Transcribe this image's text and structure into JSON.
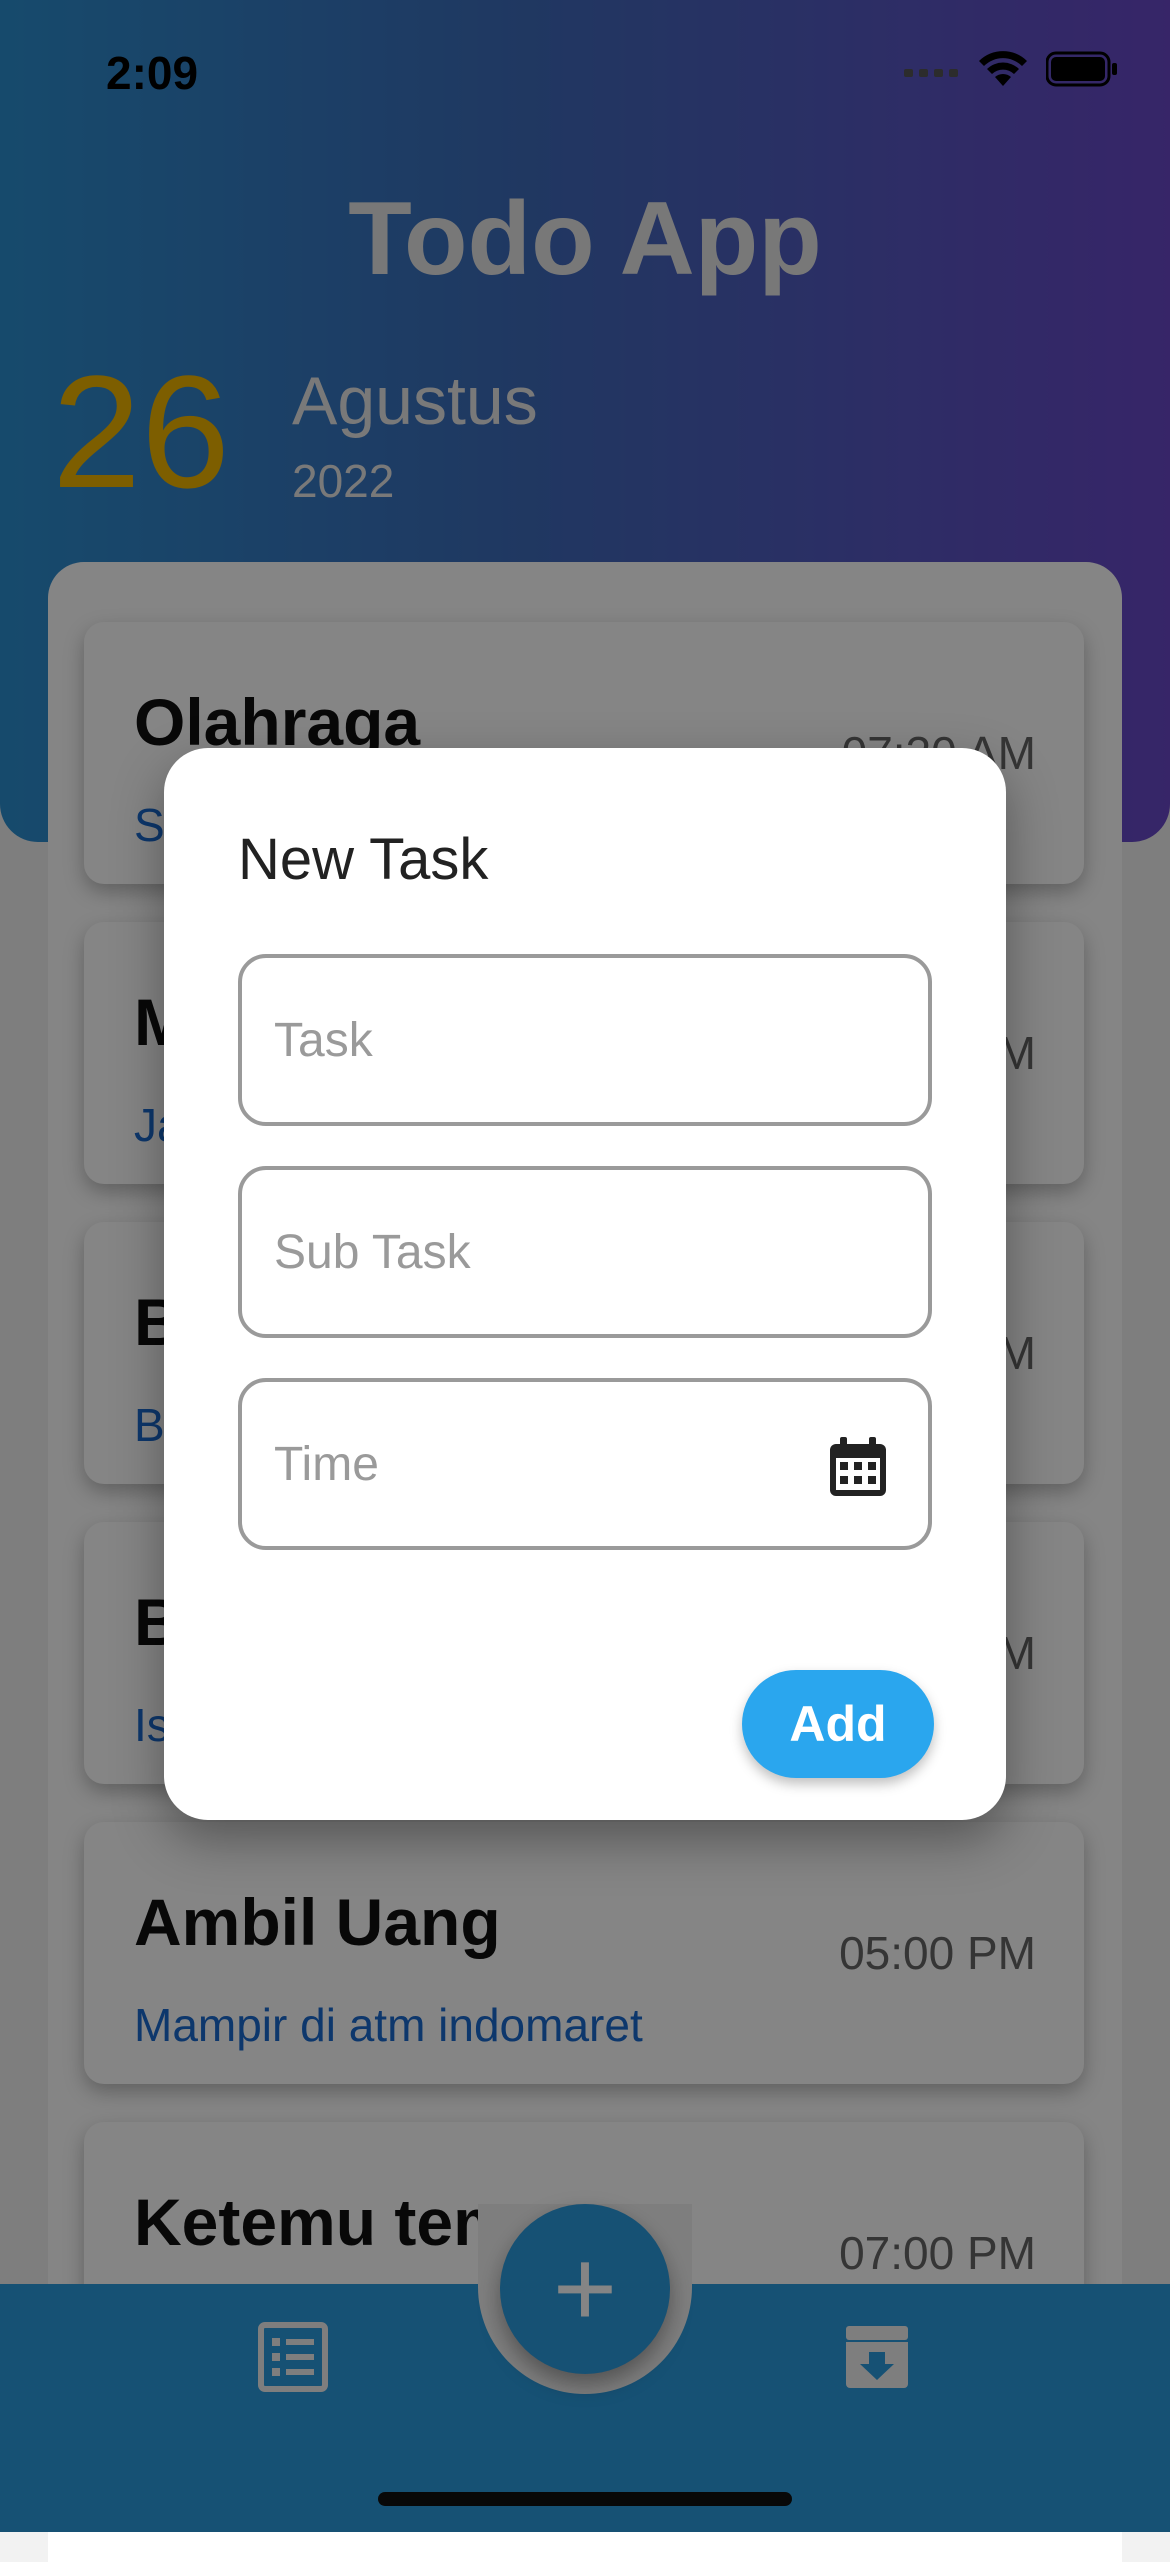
{
  "status_bar": {
    "time": "2:09",
    "icons": [
      "signal-icon",
      "wifi-icon",
      "battery-icon"
    ]
  },
  "header": {
    "title": "Todo App",
    "date": {
      "day": "26",
      "month": "Agustus",
      "year": "2022"
    }
  },
  "tasks": [
    {
      "title": "Olahraga",
      "subtitle": "S",
      "time": "07:30 AM"
    },
    {
      "title": "M",
      "subtitle": "Ja",
      "time": "M"
    },
    {
      "title": "B",
      "subtitle": "B",
      "time": "M"
    },
    {
      "title": "B",
      "subtitle": "Is",
      "time": "M"
    },
    {
      "title": "Ambil Uang",
      "subtitle": "Mampir di atm indomaret",
      "time": "05:00 PM"
    },
    {
      "title": "Ketemu teman",
      "subtitle": "",
      "time": "07:00 PM"
    }
  ],
  "dialog": {
    "title": "New Task",
    "task_placeholder": "Task",
    "subtask_placeholder": "Sub Task",
    "time_placeholder": "Time",
    "add_label": "Add"
  },
  "bottom_nav": {
    "fab_label": "+",
    "items": [
      {
        "icon": "list-icon"
      },
      {
        "icon": "archive-download-icon"
      }
    ]
  },
  "colors": {
    "header_gradient_start": "#2b8fd0",
    "header_gradient_end": "#6a48c8",
    "date_day": "#f0b400",
    "subtitle_blue": "#1a6ad0",
    "bottom_bar": "#2b9bde",
    "add_button": "#2aa6ee"
  }
}
